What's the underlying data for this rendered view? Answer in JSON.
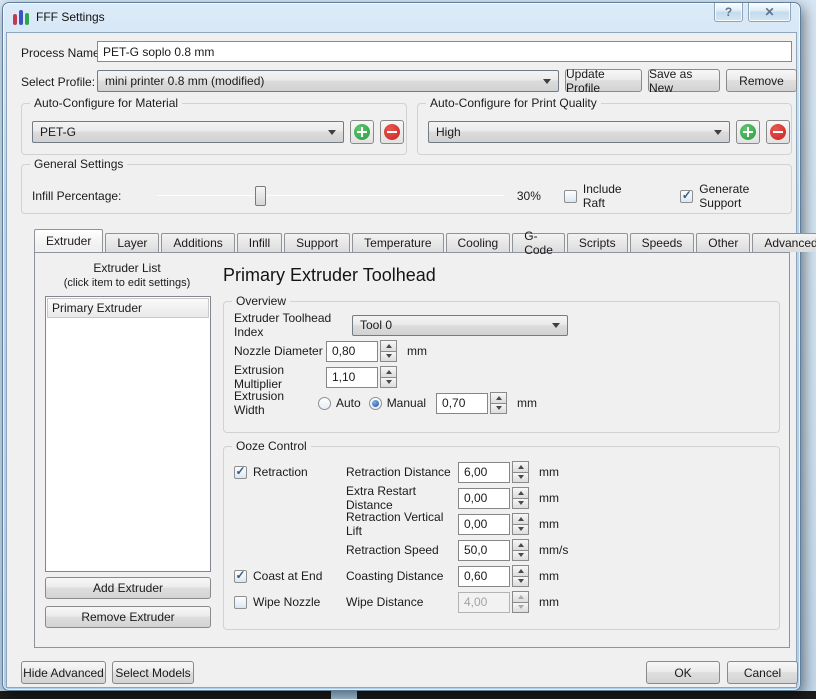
{
  "window": {
    "title": "FFF Settings"
  },
  "glyphs": {
    "help": "?",
    "close": "✕",
    "check": "✓"
  },
  "process": {
    "label": "Process Name:",
    "value": "PET-G soplo 0.8 mm"
  },
  "profile": {
    "label": "Select Profile:",
    "value": "mini printer 0.8 mm (modified)",
    "update": "Update Profile",
    "save_as_new": "Save as New",
    "remove": "Remove"
  },
  "auto_material": {
    "title": "Auto-Configure for Material",
    "value": "PET-G"
  },
  "auto_quality": {
    "title": "Auto-Configure for Print Quality",
    "value": "High"
  },
  "general": {
    "title": "General Settings",
    "infill_label": "Infill Percentage:",
    "infill_value": "30%",
    "include_raft": "Include Raft",
    "generate_support": "Generate Support"
  },
  "tabs": [
    {
      "label": "Extruder"
    },
    {
      "label": "Layer"
    },
    {
      "label": "Additions"
    },
    {
      "label": "Infill"
    },
    {
      "label": "Support"
    },
    {
      "label": "Temperature"
    },
    {
      "label": "Cooling"
    },
    {
      "label": "G-Code"
    },
    {
      "label": "Scripts"
    },
    {
      "label": "Speeds"
    },
    {
      "label": "Other"
    },
    {
      "label": "Advanced"
    }
  ],
  "extruder_list": {
    "title": "Extruder List",
    "hint": "(click item to edit settings)",
    "items": [
      {
        "label": "Primary Extruder"
      }
    ],
    "add": "Add Extruder",
    "remove": "Remove Extruder"
  },
  "toolhead": {
    "heading": "Primary Extruder Toolhead",
    "overview": {
      "title": "Overview",
      "index_label": "Extruder Toolhead Index",
      "index_value": "Tool 0",
      "nozzle_label": "Nozzle Diameter",
      "nozzle_value": "0,80",
      "nozzle_unit": "mm",
      "multiplier_label": "Extrusion Multiplier",
      "multiplier_value": "1,10",
      "width_label": "Extrusion Width",
      "width_auto": "Auto",
      "width_manual": "Manual",
      "width_value": "0,70",
      "width_unit": "mm"
    },
    "ooze": {
      "title": "Ooze Control",
      "retraction": "Retraction",
      "coast": "Coast at End",
      "wipe": "Wipe Nozzle",
      "rows": [
        {
          "label": "Retraction Distance",
          "value": "6,00",
          "unit": "mm"
        },
        {
          "label": "Extra Restart Distance",
          "value": "0,00",
          "unit": "mm"
        },
        {
          "label": "Retraction Vertical Lift",
          "value": "0,00",
          "unit": "mm"
        },
        {
          "label": "Retraction Speed",
          "value": "50,0",
          "unit": "mm/s"
        },
        {
          "label": "Coasting Distance",
          "value": "0,60",
          "unit": "mm"
        },
        {
          "label": "Wipe Distance",
          "value": "4,00",
          "unit": "mm"
        }
      ]
    }
  },
  "footer": {
    "hide_advanced": "Hide Advanced",
    "select_models": "Select Models",
    "ok": "OK",
    "cancel": "Cancel"
  },
  "state": {
    "infill_percent": 30,
    "include_raft_checked": false,
    "generate_support_checked": true,
    "retraction_checked": true,
    "coast_checked": true,
    "wipe_checked": false,
    "extrusion_width_mode": "Manual"
  },
  "colors": {
    "accent_green": "#2b9e41",
    "accent_red": "#cc2222",
    "titlebar": "#b9d2e8",
    "client_bg": "#f0f0f0"
  }
}
